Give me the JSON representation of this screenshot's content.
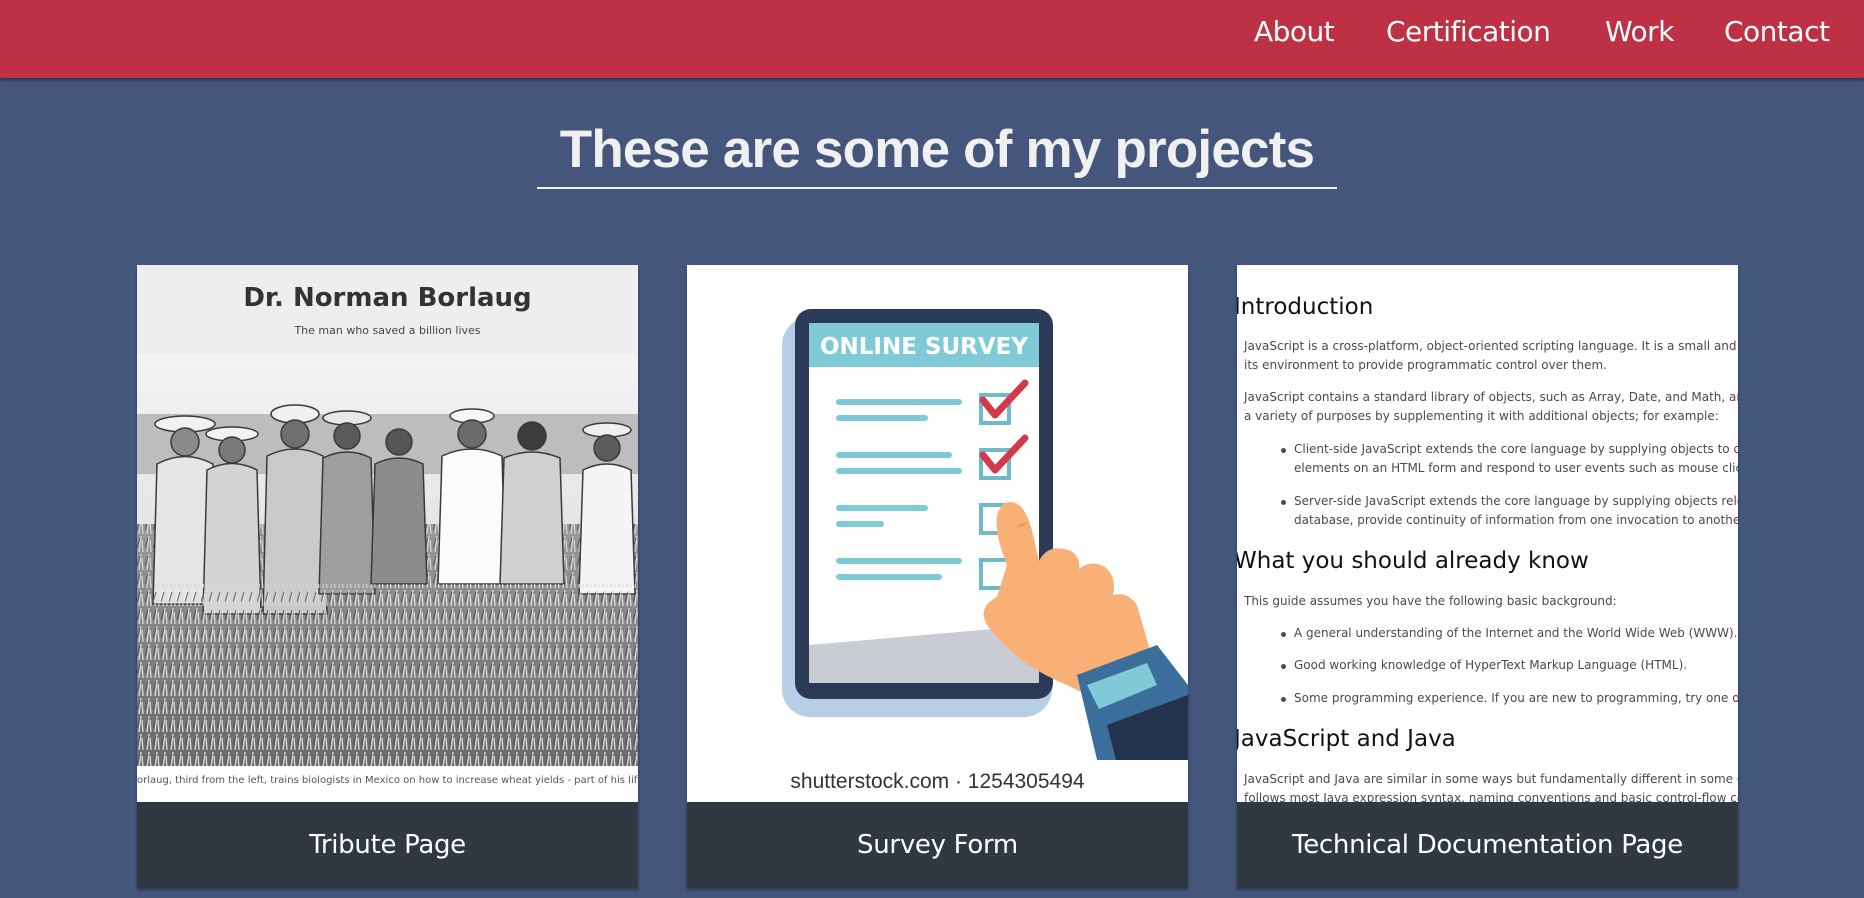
{
  "navbar": {
    "links": [
      "About",
      "Certification",
      "Work",
      "Contact"
    ],
    "background_color": "#be3144"
  },
  "page": {
    "background_color": "#45567d"
  },
  "projects_section": {
    "title": "These are some of my projects",
    "tiles": [
      {
        "label": "Tribute Page",
        "thumbnail": {
          "heading": "Dr. Norman Borlaug",
          "subheading": "The man who saved a billion lives",
          "caption": "orlaug, third from the left, trains biologists in Mexico on how to increase wheat yields - part of his life-long w",
          "image": "black-and-white photo of men standing in a wheat field"
        }
      },
      {
        "label": "Survey Form",
        "thumbnail": {
          "banner": "ONLINE SURVEY",
          "caption": "shutterstock.com · 1254305494",
          "image": "tablet with checklist and pointing hand illustration"
        }
      },
      {
        "label": "Technical Documentation Page",
        "thumbnail": {
          "sections": [
            {
              "heading": "Introduction",
              "paragraphs": [
                "JavaScript is a cross-platform, object-oriented scripting language. It is a small and ligh",
                "its environment to provide programmatic control over them.",
                "JavaScript contains a standard library of objects, such as Array, Date, and Math, and a",
                "a variety of purposes by supplementing it with additional objects; for example:"
              ],
              "bullets": [
                "Client-side JavaScript extends the core language by supplying objects to con",
                "elements on an HTML form and respond to user events such as mouse clicks",
                "Server-side JavaScript extends the core language by supplying objects relev",
                "database, provide continuity of information from one invocation to another"
              ]
            },
            {
              "heading": "What you should already know",
              "paragraphs": [
                "This guide assumes you have the following basic background:"
              ],
              "bullets": [
                "A general understanding of the Internet and the World Wide Web (WWW).",
                "Good working knowledge of HyperText Markup Language (HTML).",
                "Some programming experience. If you are new to programming, try one of t"
              ]
            },
            {
              "heading": "JavaScript and Java",
              "paragraphs": [
                "JavaScript and Java are similar in some ways but fundamentally different in some oth",
                "follows most Java expression syntax, naming conventions and basic control-flow con"
              ]
            }
          ]
        }
      }
    ]
  }
}
